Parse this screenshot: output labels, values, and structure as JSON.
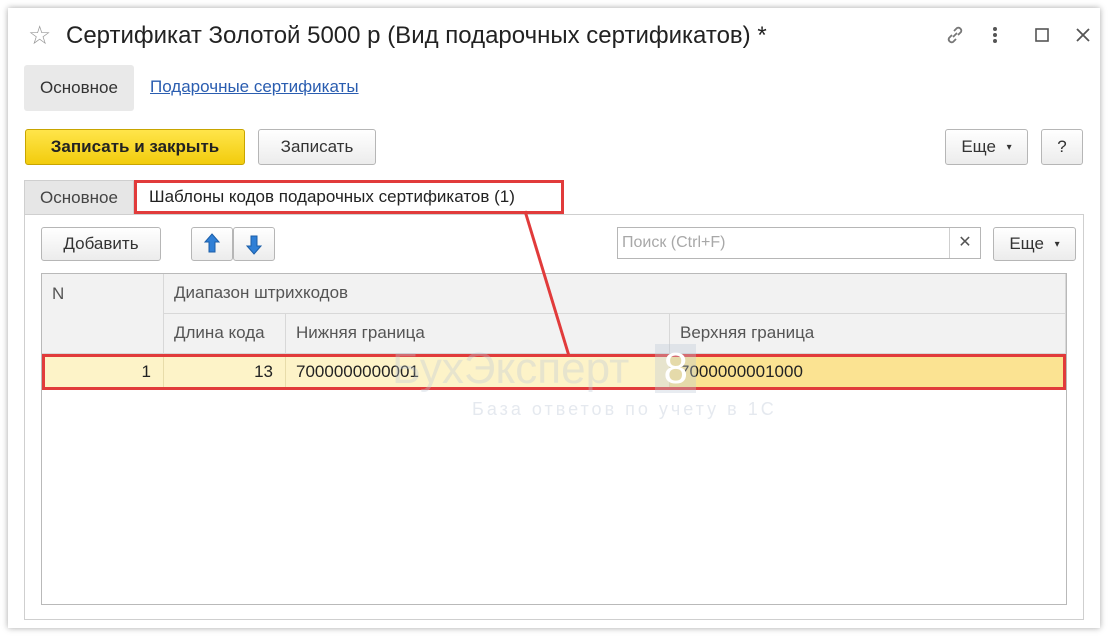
{
  "window": {
    "title": "Сертификат Золотой 5000 р (Вид подарочных сертификатов) *",
    "icons": {
      "favorite": "star-icon",
      "link": "link-icon",
      "more": "more-vertical-icon",
      "maximize": "maximize-icon",
      "close": "close-icon"
    }
  },
  "nav": {
    "main_label": "Основное",
    "link_label": "Подарочные сертификаты"
  },
  "toolbar": {
    "save_close_label": "Записать и закрыть",
    "save_label": "Записать",
    "more_label": "Еще",
    "help_label": "?"
  },
  "tabs": [
    {
      "label": "Основное"
    },
    {
      "label": "Шаблоны кодов подарочных сертификатов (1)"
    }
  ],
  "panel": {
    "add_label": "Добавить",
    "search_placeholder": "Поиск (Ctrl+F)",
    "more_label": "Еще"
  },
  "table": {
    "headers": {
      "n": "N",
      "group": "Диапазон штрихкодов",
      "length": "Длина кода",
      "lower": "Нижняя граница",
      "upper": "Верхняя граница"
    },
    "rows": [
      {
        "n": "1",
        "length": "13",
        "lower": "7000000000001",
        "upper": "7000000001000"
      }
    ]
  },
  "watermark": {
    "brand": "БухЭксперт",
    "version": "8",
    "tagline": "База ответов по учету в 1С"
  },
  "colors": {
    "accent_yellow": "#f2cc0d",
    "highlight_red": "#e13b3b",
    "row_selected": "#fdf3c8",
    "link_blue": "#2a5db0"
  }
}
